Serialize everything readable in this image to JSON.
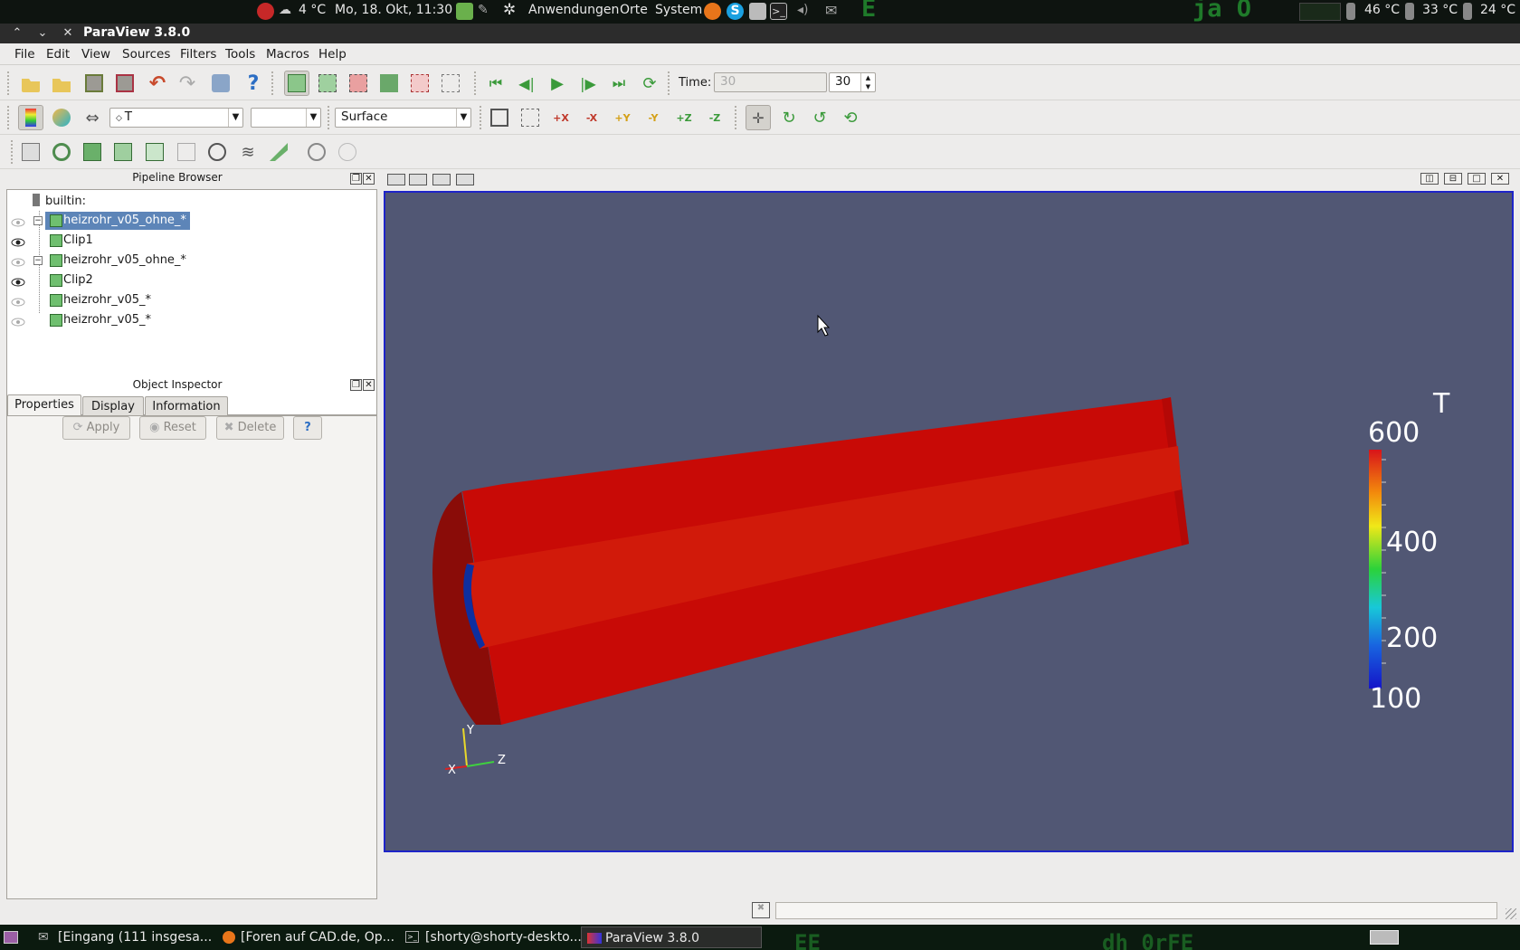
{
  "desktop_panel": {
    "weather": "4 °C",
    "datetime": "Mo, 18. Okt, 11:30",
    "menus": [
      "Anwendungen",
      "Orte",
      "System"
    ],
    "temps": [
      "46 °C",
      "33 °C",
      "24 °C"
    ],
    "bg_text_top": [
      "E",
      "ja  O"
    ]
  },
  "window": {
    "title": "ParaView 3.8.0"
  },
  "menubar": [
    "File",
    "Edit",
    "View",
    "Sources",
    "Filters",
    "Tools",
    "Macros",
    "Help"
  ],
  "time": {
    "label": "Time:",
    "value": "30",
    "step": "30"
  },
  "variable_combo": "T",
  "component_combo": "",
  "representation_combo": "Surface",
  "pipeline": {
    "title": "Pipeline Browser",
    "root": "builtin:",
    "items": [
      {
        "label": "heizrohr_v05_ohne_*",
        "visible": false,
        "selected": true
      },
      {
        "label": "Clip1",
        "visible": true
      },
      {
        "label": "heizrohr_v05_ohne_*",
        "visible": false
      },
      {
        "label": "Clip2",
        "visible": true
      },
      {
        "label": "heizrohr_v05_*",
        "visible": false
      },
      {
        "label": "heizrohr_v05_*",
        "visible": false
      }
    ]
  },
  "inspector": {
    "title": "Object Inspector",
    "tabs": [
      "Properties",
      "Display",
      "Information"
    ],
    "buttons": {
      "apply": "Apply",
      "reset": "Reset",
      "delete": "Delete",
      "help": "?"
    }
  },
  "render_view": {
    "colorbar": {
      "title": "T",
      "max": "600",
      "mid_high": "400",
      "mid_low": "200",
      "min": "100"
    },
    "axes": {
      "x": "X",
      "y": "Y",
      "z": "Z"
    }
  },
  "taskbar": [
    {
      "label": "[Eingang (111 insgesa...",
      "icon": "mail-icon"
    },
    {
      "label": "[Foren auf CAD.de, Op...",
      "icon": "firefox-icon"
    },
    {
      "label": "[shorty@shorty-deskto...",
      "icon": "terminal-icon"
    },
    {
      "label": "ParaView 3.8.0",
      "icon": "paraview-icon",
      "active": true
    }
  ],
  "bg_text_bottom": [
    "EE",
    "dh 0rFE"
  ]
}
